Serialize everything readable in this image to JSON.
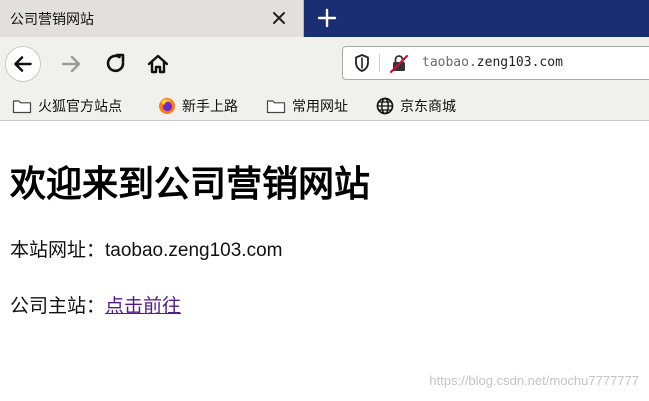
{
  "tab": {
    "title": "公司营销网站"
  },
  "address_bar": {
    "url_host_main": "taobao.",
    "url_host_rest": "zeng103.com"
  },
  "bookmarks": [
    {
      "label": "火狐官方站点",
      "icon": "folder-icon"
    },
    {
      "label": "新手上路",
      "icon": "firefox-icon"
    },
    {
      "label": "常用网址",
      "icon": "folder-icon"
    },
    {
      "label": "京东商城",
      "icon": "globe-icon"
    }
  ],
  "page": {
    "heading": "欢迎来到公司营销网站",
    "site_label": "本站网址：",
    "site_value": "taobao.zeng103.com",
    "main_label": "公司主站：",
    "main_link": "点击前往"
  },
  "watermark": "https://blog.csdn.net/mochu7777777",
  "colors": {
    "tabstrip": "#1a2f73",
    "tab_active": "#e1e0dc",
    "toolbar": "#f0f0ed",
    "link_visited": "#551a8b"
  }
}
